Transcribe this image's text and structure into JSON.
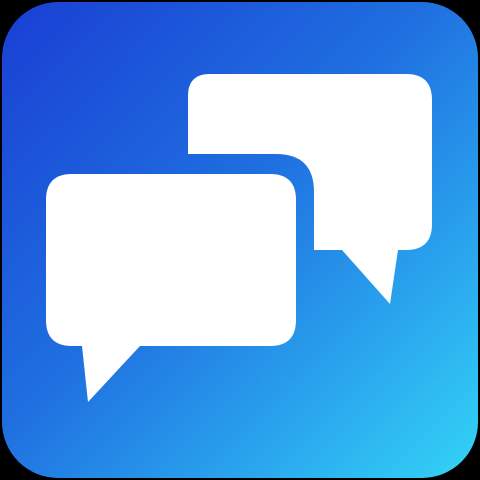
{
  "app_icon": {
    "icon": "chat-bubbles-icon",
    "colors": {
      "gradient_start": "#1a3fd4",
      "gradient_mid": "#1f6fe0",
      "gradient_end": "#33d4f6",
      "bubble_fill": "#ffffff",
      "background": "#000000"
    }
  }
}
